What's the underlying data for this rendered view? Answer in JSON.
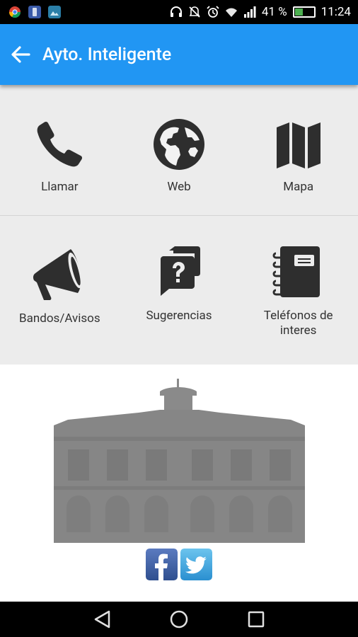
{
  "status_bar": {
    "battery_percent": "41 %",
    "time": "11:24",
    "battery_level": 0.41
  },
  "app_bar": {
    "title": "Ayto. Inteligente"
  },
  "grid": {
    "row1": [
      {
        "label": "Llamar",
        "icon": "phone-icon"
      },
      {
        "label": "Web",
        "icon": "globe-icon"
      },
      {
        "label": "Mapa",
        "icon": "map-icon"
      }
    ],
    "row2": [
      {
        "label": "Bandos/Avisos",
        "icon": "megaphone-icon"
      },
      {
        "label": "Sugerencias",
        "icon": "question-chat-icon"
      },
      {
        "label": "Teléfonos de interes",
        "icon": "address-book-icon"
      }
    ]
  },
  "colors": {
    "app_bar": "#2196f3",
    "icon": "#2e2e2e",
    "facebook": "#3b5998",
    "twitter": "#3fa9e0"
  },
  "social": {
    "facebook_icon": "facebook-icon",
    "twitter_icon": "twitter-icon"
  }
}
